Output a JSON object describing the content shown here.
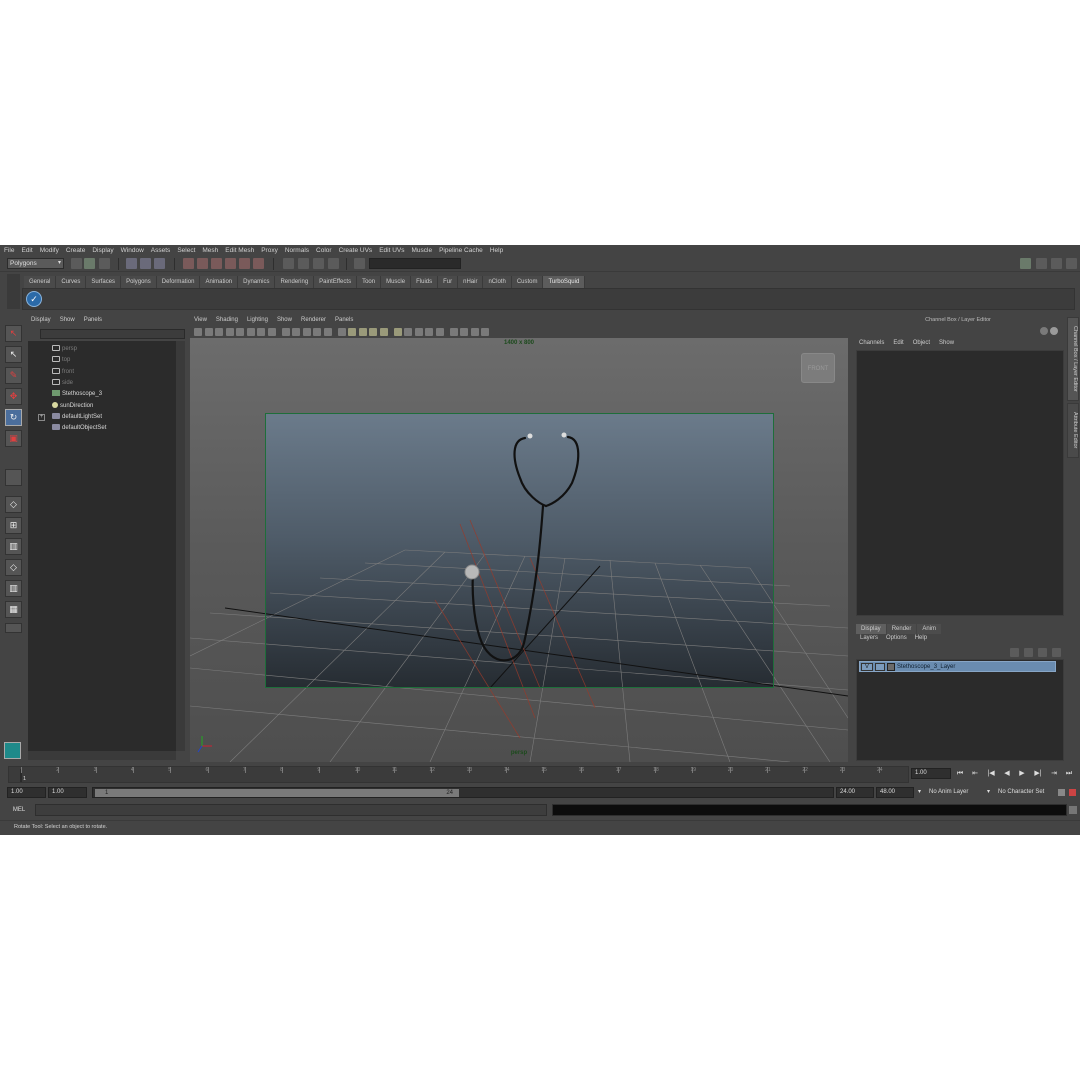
{
  "menubar": [
    "File",
    "Edit",
    "Modify",
    "Create",
    "Display",
    "Window",
    "Assets",
    "Select",
    "Mesh",
    "Edit Mesh",
    "Proxy",
    "Normals",
    "Color",
    "Create UVs",
    "Edit UVs",
    "Muscle",
    "Pipeline Cache",
    "Help"
  ],
  "status_line": {
    "mode": "Polygons"
  },
  "shelf": {
    "tabs": [
      "General",
      "Curves",
      "Surfaces",
      "Polygons",
      "Deformation",
      "Animation",
      "Dynamics",
      "Rendering",
      "PaintEffects",
      "Toon",
      "Muscle",
      "Fluids",
      "Fur",
      "nHair",
      "nCloth",
      "Custom",
      "TurboSquid"
    ],
    "active_tab": "TurboSquid",
    "icon": "turbosquid-check-icon"
  },
  "outliner": {
    "menu": [
      "Display",
      "Show",
      "Panels"
    ],
    "items": [
      {
        "label": "persp",
        "dim": true,
        "icon": "camera"
      },
      {
        "label": "top",
        "dim": true,
        "icon": "camera"
      },
      {
        "label": "front",
        "dim": true,
        "icon": "camera"
      },
      {
        "label": "side",
        "dim": true,
        "icon": "camera"
      },
      {
        "label": "Stethoscope_3",
        "dim": false,
        "icon": "mesh"
      },
      {
        "label": "sunDirection",
        "dim": false,
        "icon": "light"
      },
      {
        "label": "defaultLightSet",
        "dim": false,
        "icon": "set"
      },
      {
        "label": "defaultObjectSet",
        "dim": false,
        "icon": "set"
      }
    ]
  },
  "viewport": {
    "menu": [
      "View",
      "Shading",
      "Lighting",
      "Show",
      "Renderer",
      "Panels"
    ],
    "resolution_label": "1400 x 800",
    "camera_label": "persp",
    "viewcube_label": "FRONT"
  },
  "channel_box": {
    "title": "Channel Box / Layer Editor",
    "menu": [
      "Channels",
      "Edit",
      "Object",
      "Show"
    ],
    "side_tabs": [
      "Channel Box / Layer Editor",
      "Attribute Editor"
    ]
  },
  "layer_editor": {
    "tabs": [
      "Display",
      "Render",
      "Anim"
    ],
    "active_tab": "Display",
    "menu": [
      "Layers",
      "Options",
      "Help"
    ],
    "layers": [
      {
        "visible": "V",
        "name": "Stethoscope_3_Layer"
      }
    ]
  },
  "timeline": {
    "ticks": [
      "1",
      "2",
      "3",
      "4",
      "5",
      "6",
      "7",
      "8",
      "9",
      "10",
      "11",
      "12",
      "13",
      "14",
      "15",
      "16",
      "17",
      "18",
      "19",
      "20",
      "21",
      "22",
      "23",
      "24"
    ],
    "current_frame": "1.00",
    "start_field": "1.00",
    "playback_start": "1.00",
    "range_start": "1",
    "range_end": "24",
    "playback_end": "24.00",
    "end_field": "48.00",
    "anim_layer": "No Anim Layer",
    "character_set": "No Character Set"
  },
  "command_line": {
    "label": "MEL"
  },
  "help_line": "Rotate Tool: Select an object to rotate.",
  "colors": {
    "background": "#444444",
    "panel_dark": "#2b2b2b",
    "layer_highlight": "#6a8cb0",
    "resolution_gate": "#1e6e3a"
  }
}
